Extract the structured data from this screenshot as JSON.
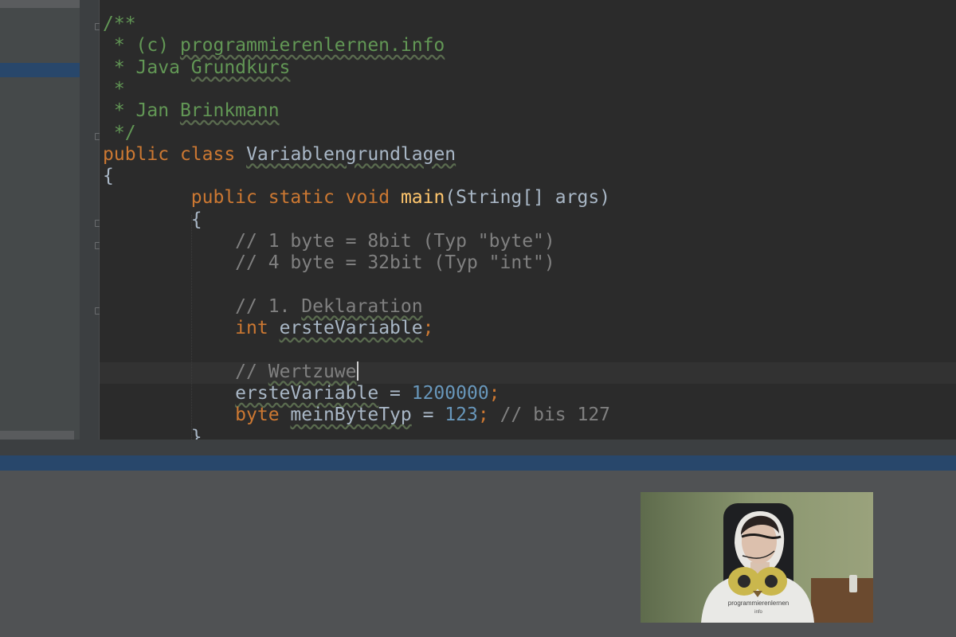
{
  "editor": {
    "lines": [
      {
        "id": "l1",
        "tokens": [
          {
            "t": "/**",
            "c": "doc"
          }
        ]
      },
      {
        "id": "l2",
        "tokens": [
          {
            "t": " * (c) ",
            "c": "doc"
          },
          {
            "t": "programmierenlernen.info",
            "c": "doc u"
          }
        ]
      },
      {
        "id": "l3",
        "tokens": [
          {
            "t": " * Java ",
            "c": "doc"
          },
          {
            "t": "Grundkurs",
            "c": "doc u"
          }
        ]
      },
      {
        "id": "l4",
        "tokens": [
          {
            "t": " *",
            "c": "doc"
          }
        ]
      },
      {
        "id": "l5",
        "tokens": [
          {
            "t": " * Jan ",
            "c": "doc"
          },
          {
            "t": "Brinkmann",
            "c": "doc u"
          }
        ]
      },
      {
        "id": "l6",
        "tokens": [
          {
            "t": " */",
            "c": "doc"
          }
        ]
      },
      {
        "id": "l7",
        "tokens": [
          {
            "t": "public",
            "c": "kw"
          },
          {
            "t": " "
          },
          {
            "t": "class",
            "c": "kw"
          },
          {
            "t": " "
          },
          {
            "t": "Variablengrundlagen",
            "c": "u"
          }
        ]
      },
      {
        "id": "l8",
        "tokens": [
          {
            "t": "{"
          }
        ]
      },
      {
        "id": "l9",
        "tokens": [
          {
            "t": "        "
          },
          {
            "t": "public",
            "c": "kw"
          },
          {
            "t": " "
          },
          {
            "t": "static",
            "c": "kw"
          },
          {
            "t": " "
          },
          {
            "t": "void",
            "c": "kw"
          },
          {
            "t": " "
          },
          {
            "t": "main",
            "c": "fn"
          },
          {
            "t": "(String[] args)"
          }
        ]
      },
      {
        "id": "l10",
        "tokens": [
          {
            "t": "        {"
          }
        ]
      },
      {
        "id": "l11",
        "tokens": [
          {
            "t": "            "
          },
          {
            "t": "// 1 byte = 8bit (Typ \"byte\")",
            "c": "cmt"
          }
        ]
      },
      {
        "id": "l12",
        "tokens": [
          {
            "t": "            "
          },
          {
            "t": "// 4 byte = 32bit (Typ \"int\")",
            "c": "cmt"
          }
        ]
      },
      {
        "id": "l13",
        "tokens": []
      },
      {
        "id": "l14",
        "tokens": [
          {
            "t": "            "
          },
          {
            "t": "// 1. ",
            "c": "cmt"
          },
          {
            "t": "Deklaration",
            "c": "cmt u"
          }
        ]
      },
      {
        "id": "l15",
        "tokens": [
          {
            "t": "            "
          },
          {
            "t": "int",
            "c": "kw"
          },
          {
            "t": " "
          },
          {
            "t": "ersteVariable",
            "c": "var u"
          },
          {
            "t": ";",
            "c": "kw"
          }
        ]
      },
      {
        "id": "l16",
        "tokens": []
      },
      {
        "id": "l17",
        "tokens": [
          {
            "t": "            "
          },
          {
            "t": "// ",
            "c": "cmt"
          },
          {
            "t": "Wertzuwe",
            "c": "cmt u"
          }
        ],
        "caret": true
      },
      {
        "id": "l18",
        "tokens": [
          {
            "t": "            "
          },
          {
            "t": "ersteVariable",
            "c": "var u"
          },
          {
            "t": " = "
          },
          {
            "t": "1200000",
            "c": "num"
          },
          {
            "t": ";",
            "c": "kw"
          }
        ]
      },
      {
        "id": "l19",
        "tokens": [
          {
            "t": "            "
          },
          {
            "t": "byte",
            "c": "kw"
          },
          {
            "t": " "
          },
          {
            "t": "meinByteTyp",
            "c": "var u"
          },
          {
            "t": " = "
          },
          {
            "t": "123",
            "c": "num"
          },
          {
            "t": ";",
            "c": "kw"
          },
          {
            "t": " "
          },
          {
            "t": "// bis 127",
            "c": "cmt"
          }
        ]
      },
      {
        "id": "l20",
        "tokens": [
          {
            "t": "        }"
          }
        ]
      }
    ]
  },
  "colors": {
    "keyword": "#cc7832",
    "function": "#ffc66d",
    "number": "#6897bb",
    "doc_comment": "#629755",
    "comment": "#808080",
    "text": "#a9b7c6",
    "editor_bg": "#2b2b2b",
    "selection_accent": "#28476b"
  },
  "webcam": {
    "icon": "presenter-webcam-overlay",
    "shirt_text": "programmierenlernen",
    "shirt_text_2": "info"
  }
}
